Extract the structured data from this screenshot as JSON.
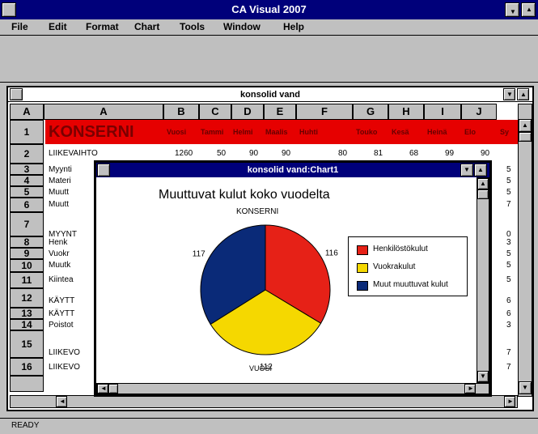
{
  "app": {
    "title": "CA Visual 2007"
  },
  "menu": {
    "items": [
      "File",
      "Edit",
      "Format",
      "Chart",
      "Tools",
      "Window",
      "Help"
    ]
  },
  "sheet": {
    "title": "konsolid vand",
    "corner": "A",
    "columns": [
      "A",
      "B",
      "C",
      "D",
      "E",
      "F",
      "G",
      "H",
      "I",
      "J"
    ],
    "rows": [
      "1",
      "2",
      "3",
      "4",
      "5",
      "6",
      "7",
      "8",
      "9",
      "10",
      "11",
      "12",
      "13",
      "14",
      "15",
      "16"
    ],
    "row1": {
      "label": "KONSERNI",
      "cells": [
        "Vuosi",
        "Tammi",
        "Helmi",
        "Maalis",
        "Huhti",
        "Touko",
        "Kesä",
        "Heinä",
        "Elo",
        "Sy"
      ]
    },
    "row2": {
      "label": "LIIKEVAIHTO",
      "values": [
        "1260",
        "50",
        "90",
        "90",
        "80",
        "81",
        "68",
        "99",
        "90"
      ]
    },
    "row_labels": {
      "r3": "Myynti",
      "r4": "Materi",
      "r5": "Muutt",
      "r6": "Muutt",
      "r7": "MYYNT",
      "r8": "Henk",
      "r9": "Vuokr",
      "r10": "Muutk",
      "r11": "Kiintea",
      "r12": "KÄYTT",
      "r13": "KÄYTT",
      "r14": "Poistot",
      "r15": "LIIKEVO",
      "r16": "LIIKEVO"
    },
    "right_edge_digits": [
      "5",
      "5",
      "5",
      "7",
      "0",
      "3",
      "5",
      "5",
      "5",
      "6",
      "6",
      "3",
      "7",
      "7"
    ]
  },
  "chart_window": {
    "title": "konsolid vand:Chart1"
  },
  "chart_data": {
    "type": "pie",
    "title": "Muuttuvat kulut koko vuodelta",
    "subtitle": "KONSERNI",
    "xlabel": "VUOSI",
    "categories": [
      "Henkilöstökulut",
      "Vuokrakulut",
      "Muut muuttuvat kulut"
    ],
    "values": [
      116,
      112,
      117
    ],
    "colors": [
      "#e62117",
      "#f5d800",
      "#0a2a78"
    ],
    "legend_position": "right"
  },
  "status": {
    "text": "READY"
  }
}
